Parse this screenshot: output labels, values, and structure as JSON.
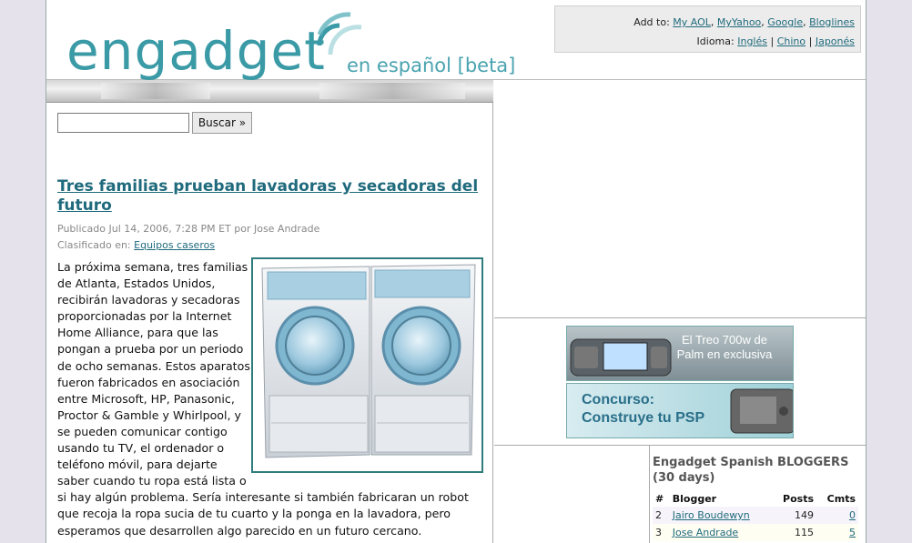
{
  "header": {
    "logo_word": "engadget",
    "logo_sub": "en español [beta]",
    "addto_label": "Add to:",
    "addto_links": [
      "My AOL",
      "MyYahoo",
      "Google",
      "Bloglines"
    ],
    "lang_label": "Idioma:",
    "lang_links": [
      "Inglés",
      "Chino",
      "Japonés"
    ]
  },
  "search": {
    "input_value": "",
    "button_label": "Buscar »"
  },
  "article": {
    "title": "Tres familias prueban lavadoras y secadoras del futuro",
    "published": "Publicado Jul 14, 2006, 7:28 PM ET por Jose Andrade",
    "classified_label": "Clasificado en:",
    "category": "Equipos caseros",
    "body": "La próxima semana, tres familias de Atlanta, Estados Unidos, recibirán lavadoras y secadoras proporcionadas por la Internet Home Alliance, para que las pongan a prueba por un periodo de ocho semanas. Estos aparatos fueron fabricados en asociación entre Microsoft, HP, Panasonic, Proctor & Gamble y Whirlpool, y se pueden comunicar contigo usando tu TV, el ordenador o teléfono móvil, para dejarte saber cuando tu ropa está lista o si hay algún problema. Sería interesante si también fabricaran un robot que recoja la ropa sucia de tu cuarto y la ponga en la lavadora, pero esperamos que desarrollen algo parecido en un futuro cercano."
  },
  "promos": {
    "treo": "El Treo 700w de Palm en exclusiva",
    "psp_line1": "Concurso:",
    "psp_line2": "Construye tu PSP"
  },
  "bloggers": {
    "title": "Engadget Spanish BLOGGERS (30 days)",
    "columns": [
      "#",
      "Blogger",
      "Posts",
      "Cmts"
    ],
    "rows": [
      {
        "rank": "2",
        "name": "Jairo Boudewyn",
        "posts": "149",
        "cmts": "0"
      },
      {
        "rank": "3",
        "name": "Jose Andrade",
        "posts": "115",
        "cmts": "5"
      }
    ]
  },
  "colors": {
    "brand": "#3a9aa6",
    "link": "#1f6a7c"
  }
}
